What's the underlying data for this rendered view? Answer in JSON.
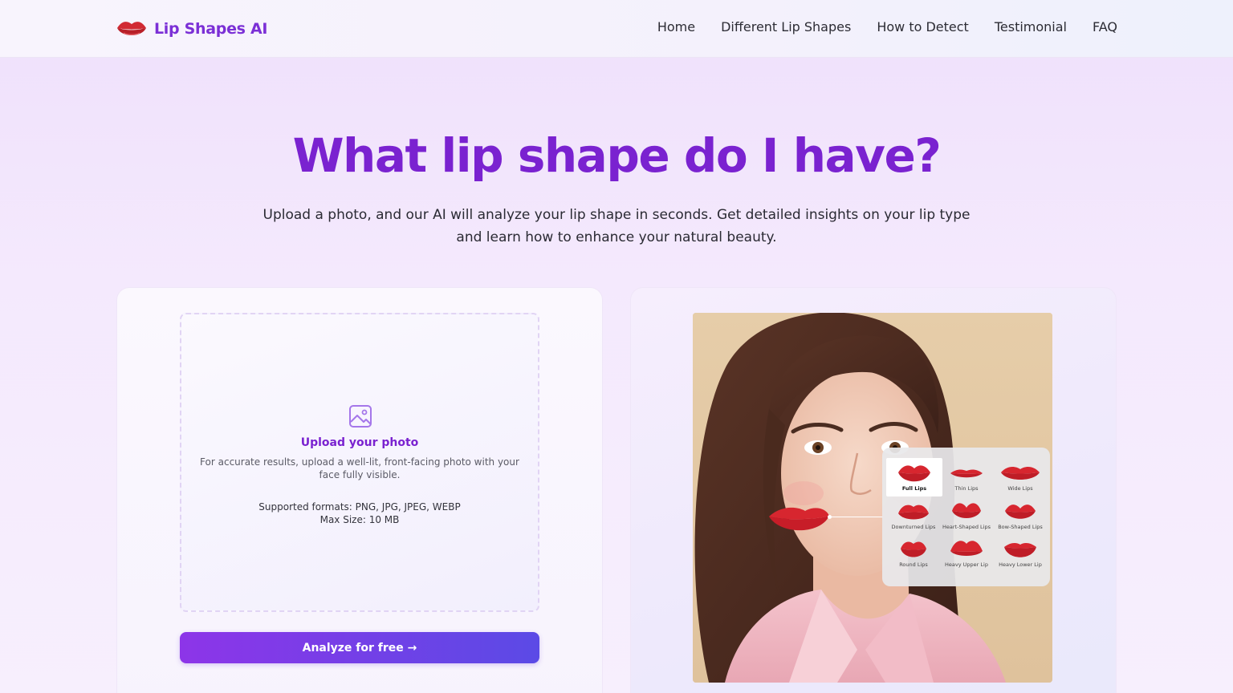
{
  "header": {
    "brand": "Lip Shapes AI",
    "nav": [
      {
        "label": "Home"
      },
      {
        "label": "Different Lip Shapes"
      },
      {
        "label": "How to Detect"
      },
      {
        "label": "Testimonial"
      },
      {
        "label": "FAQ"
      }
    ]
  },
  "hero": {
    "title": "What lip shape do I have?",
    "subtitle": "Upload a photo, and our AI will analyze your lip shape in seconds. Get detailed insights on your lip type and learn how to enhance your natural beauty."
  },
  "upload": {
    "title": "Upload your photo",
    "description": "For accurate results, upload a well-lit, front-facing photo with your face fully visible.",
    "formats": "Supported formats: PNG, JPG, JPEG, WEBP",
    "max_size": "Max Size: 10 MB",
    "button": "Analyze for free →"
  },
  "lip_types": [
    {
      "label": "Full Lips",
      "active": true
    },
    {
      "label": "Thin Lips"
    },
    {
      "label": "Wide Lips"
    },
    {
      "label": "Downturned Lips"
    },
    {
      "label": "Heart-Shaped Lips"
    },
    {
      "label": "Bow-Shaped Lips"
    },
    {
      "label": "Round Lips"
    },
    {
      "label": "Heavy Upper Lip"
    },
    {
      "label": "Heavy Lower Lip"
    }
  ],
  "colors": {
    "brand": "#7a22d0",
    "button_start": "#8d35e8",
    "button_end": "#5b4ae6",
    "lip_red": "#d7262f"
  },
  "icons": {
    "logo": "lips-icon",
    "upload": "image-icon"
  }
}
